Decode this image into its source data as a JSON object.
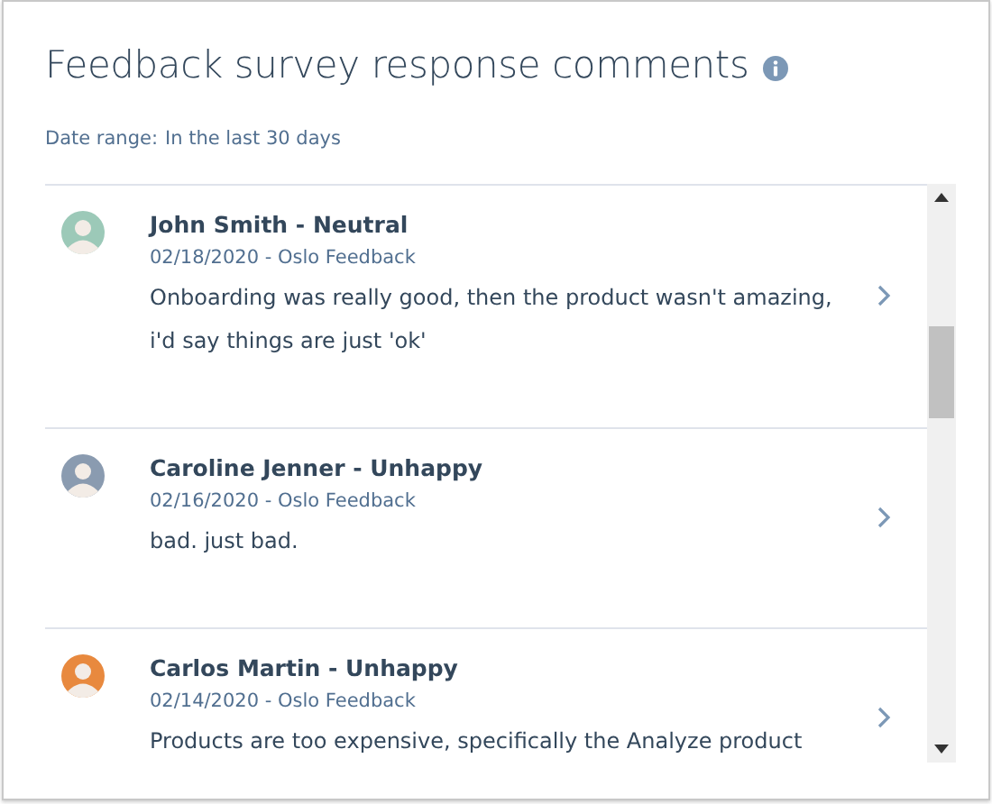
{
  "title": "Feedback survey response comments",
  "date_range": {
    "label": "Date range:",
    "value": "In the last 30 days"
  },
  "comments": [
    {
      "name": "John Smith - Neutral",
      "meta": "02/18/2020 - Oslo Feedback",
      "text": "Onboarding was really good, then the product wasn't amazing, i'd say things are just 'ok'"
    },
    {
      "name": "Caroline Jenner - Unhappy",
      "meta": "02/16/2020 - Oslo Feedback",
      "text": "bad. just bad."
    },
    {
      "name": "Carlos Martin - Unhappy",
      "meta": "02/14/2020 - Oslo Feedback",
      "text": "Products are too expensive, specifically the Analyze product"
    }
  ]
}
